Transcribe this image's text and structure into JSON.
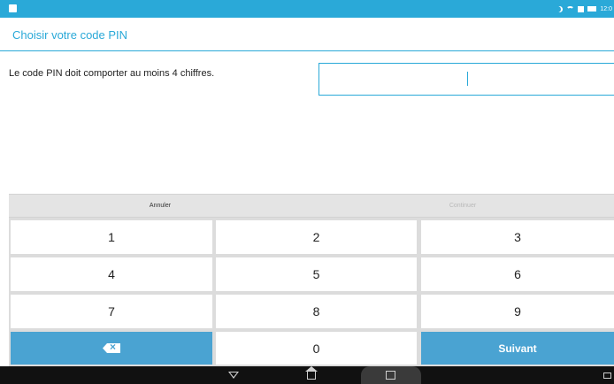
{
  "title": "Choisir votre code PIN",
  "instruction": "Le code PIN doit comporter au moins 4 chiffres.",
  "pin_input": {
    "value": ""
  },
  "actions": {
    "cancel": "Annuler",
    "continue": "Continuer"
  },
  "keypad": {
    "k1": "1",
    "k2": "2",
    "k3": "3",
    "k4": "4",
    "k5": "5",
    "k6": "6",
    "k7": "7",
    "k8": "8",
    "k9": "9",
    "k0": "0",
    "delete_icon": "backspace-icon",
    "next": "Suivant"
  },
  "status_bar": {
    "time": "12:0"
  },
  "colors": {
    "accent": "#2aa9d8",
    "key_blue": "#4aa3d2",
    "navbar": "#111111"
  },
  "nav_icons": [
    "back-icon",
    "home-icon",
    "recent-apps-icon",
    "keyboard-icon"
  ]
}
